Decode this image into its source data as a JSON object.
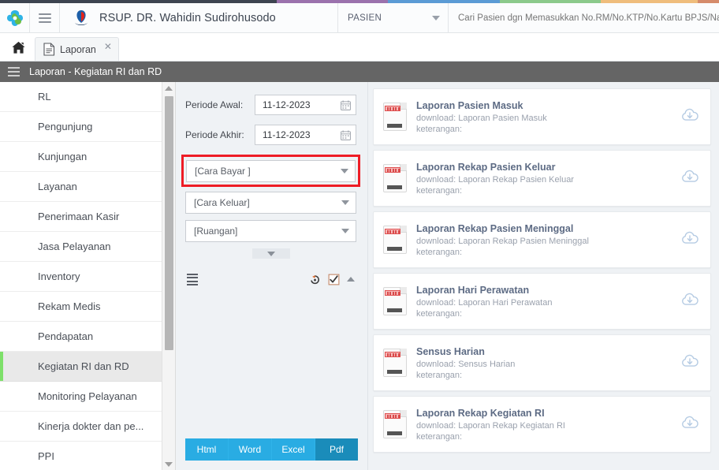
{
  "topstrip": {
    "colors": [
      "#3d4450",
      "#9b72ad",
      "#5b9bd5",
      "#8bc98b",
      "#efbd7c",
      "#d58b6b"
    ]
  },
  "header": {
    "app_logo_icon": "app-logo-icon",
    "menu_icon": "hamburger-menu-icon",
    "brand_logo_icon": "hospital-logo-icon",
    "brand_name": "RSUP. DR. Wahidin Sudirohusodo",
    "context_select": {
      "value": "PASIEN",
      "caret_icon": "chevron-down-icon"
    },
    "search": {
      "value": "",
      "placeholder": "Cari Pasien dgn Memasukkan No.RM/No.KTP/No.Kartu BPJS/Nama"
    }
  },
  "tabbar": {
    "home_icon": "home-icon",
    "tabs": [
      {
        "label": "Laporan",
        "doc_icon": "document-icon",
        "close_icon": "close-icon"
      }
    ]
  },
  "pagebar": {
    "menu_icon": "list-menu-icon",
    "title": "Laporan - Kegiatan RI dan RD"
  },
  "sidebar": {
    "items": [
      {
        "label": "RL",
        "active": false
      },
      {
        "label": "Pengunjung",
        "active": false
      },
      {
        "label": "Kunjungan",
        "active": false
      },
      {
        "label": "Layanan",
        "active": false
      },
      {
        "label": "Penerimaan Kasir",
        "active": false
      },
      {
        "label": "Jasa Pelayanan",
        "active": false
      },
      {
        "label": "Inventory",
        "active": false
      },
      {
        "label": "Rekam Medis",
        "active": false
      },
      {
        "label": "Pendapatan",
        "active": false
      },
      {
        "label": "Kegiatan RI dan RD",
        "active": true
      },
      {
        "label": "Monitoring Pelayanan",
        "active": false
      },
      {
        "label": "Kinerja dokter dan pe...",
        "active": false
      },
      {
        "label": "PPI",
        "active": false
      }
    ],
    "scroll_up_icon": "scroll-up-arrow-icon",
    "scroll_down_icon": "scroll-down-arrow-icon",
    "active_marker_color": "#7ee06a"
  },
  "filters": {
    "periode_awal": {
      "label": "Periode Awal:",
      "value": "11-12-2023",
      "icon": "calendar-icon"
    },
    "periode_akhir": {
      "label": "Periode Akhir:",
      "value": "11-12-2023",
      "icon": "calendar-icon"
    },
    "selects": [
      {
        "value": "[Cara Bayar ]",
        "highlighted": true,
        "caret_icon": "chevron-down-icon"
      },
      {
        "value": "[Cara Keluar]",
        "highlighted": false,
        "caret_icon": "chevron-down-icon"
      },
      {
        "value": "[Ruangan]",
        "highlighted": false,
        "caret_icon": "chevron-down-icon"
      }
    ],
    "highlight_color": "#ee1c25",
    "expander_icon": "chevron-down-icon",
    "toolbar": {
      "list_icon": "list-lines-icon",
      "history_icon": "history-revert-icon",
      "checkbox_icon": "checkbox-checked-icon",
      "collapse_icon": "chevron-up-icon"
    }
  },
  "export": {
    "buttons": [
      {
        "label": "Html",
        "active": false
      },
      {
        "label": "Word",
        "active": false
      },
      {
        "label": "Excel",
        "active": false
      },
      {
        "label": "Pdf",
        "active": true
      }
    ],
    "color": "#29ace3",
    "active_color": "#1a8cba"
  },
  "reports": {
    "download_prefix": "download: ",
    "note_label": "keterangan:",
    "items": [
      {
        "title": "Laporan Pasien Masuk",
        "download": "download: Laporan Pasien Masuk",
        "note": "keterangan:",
        "doc_icon": "report-document-icon",
        "download_icon": "cloud-download-icon"
      },
      {
        "title": "Laporan Rekap Pasien Keluar",
        "download": "download: Laporan Rekap Pasien Keluar",
        "note": "keterangan:",
        "doc_icon": "report-document-icon",
        "download_icon": "cloud-download-icon"
      },
      {
        "title": "Laporan Rekap Pasien Meninggal",
        "download": "download: Laporan Rekap Pasien Meninggal",
        "note": "keterangan:",
        "doc_icon": "report-document-icon",
        "download_icon": "cloud-download-icon"
      },
      {
        "title": "Laporan Hari Perawatan",
        "download": "download: Laporan Hari Perawatan",
        "note": "keterangan:",
        "doc_icon": "report-document-icon",
        "download_icon": "cloud-download-icon"
      },
      {
        "title": "Sensus Harian",
        "download": "download: Sensus Harian",
        "note": "keterangan:",
        "doc_icon": "report-document-icon",
        "download_icon": "cloud-download-icon"
      },
      {
        "title": "Laporan Rekap Kegiatan RI",
        "download": "download: Laporan Rekap Kegiatan RI",
        "note": "keterangan:",
        "doc_icon": "report-document-icon",
        "download_icon": "cloud-download-icon"
      }
    ]
  }
}
